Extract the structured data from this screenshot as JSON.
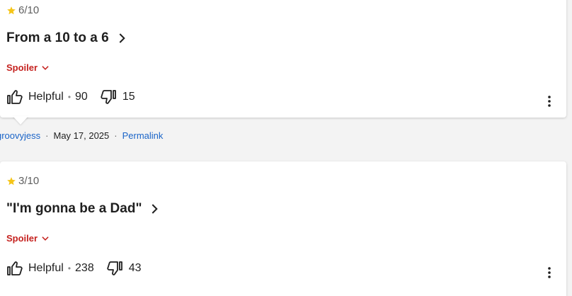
{
  "reviews": [
    {
      "rating": "6/10",
      "title": "From a 10 to a 6",
      "spoiler_label": "Spoiler",
      "helpful_label": "Helpful",
      "helpful_count": "90",
      "not_helpful_count": "15"
    },
    {
      "rating": "3/10",
      "title": "\"I'm gonna be a Dad\"",
      "spoiler_label": "Spoiler",
      "helpful_label": "Helpful",
      "helpful_count": "238",
      "not_helpful_count": "43"
    }
  ],
  "meta": {
    "author": "groovyjess",
    "date": "May 17, 2025",
    "permalink_label": "Permalink"
  },
  "colors": {
    "star": "#f5c518",
    "spoiler": "#c5221f",
    "link": "#1a64c8"
  },
  "icons": {
    "star": "star-icon",
    "chevron_right": "chevron-right-icon",
    "chevron_down": "chevron-down-icon",
    "thumb_up": "thumb-up-icon",
    "thumb_down": "thumb-down-icon",
    "more": "more-vertical-icon"
  }
}
